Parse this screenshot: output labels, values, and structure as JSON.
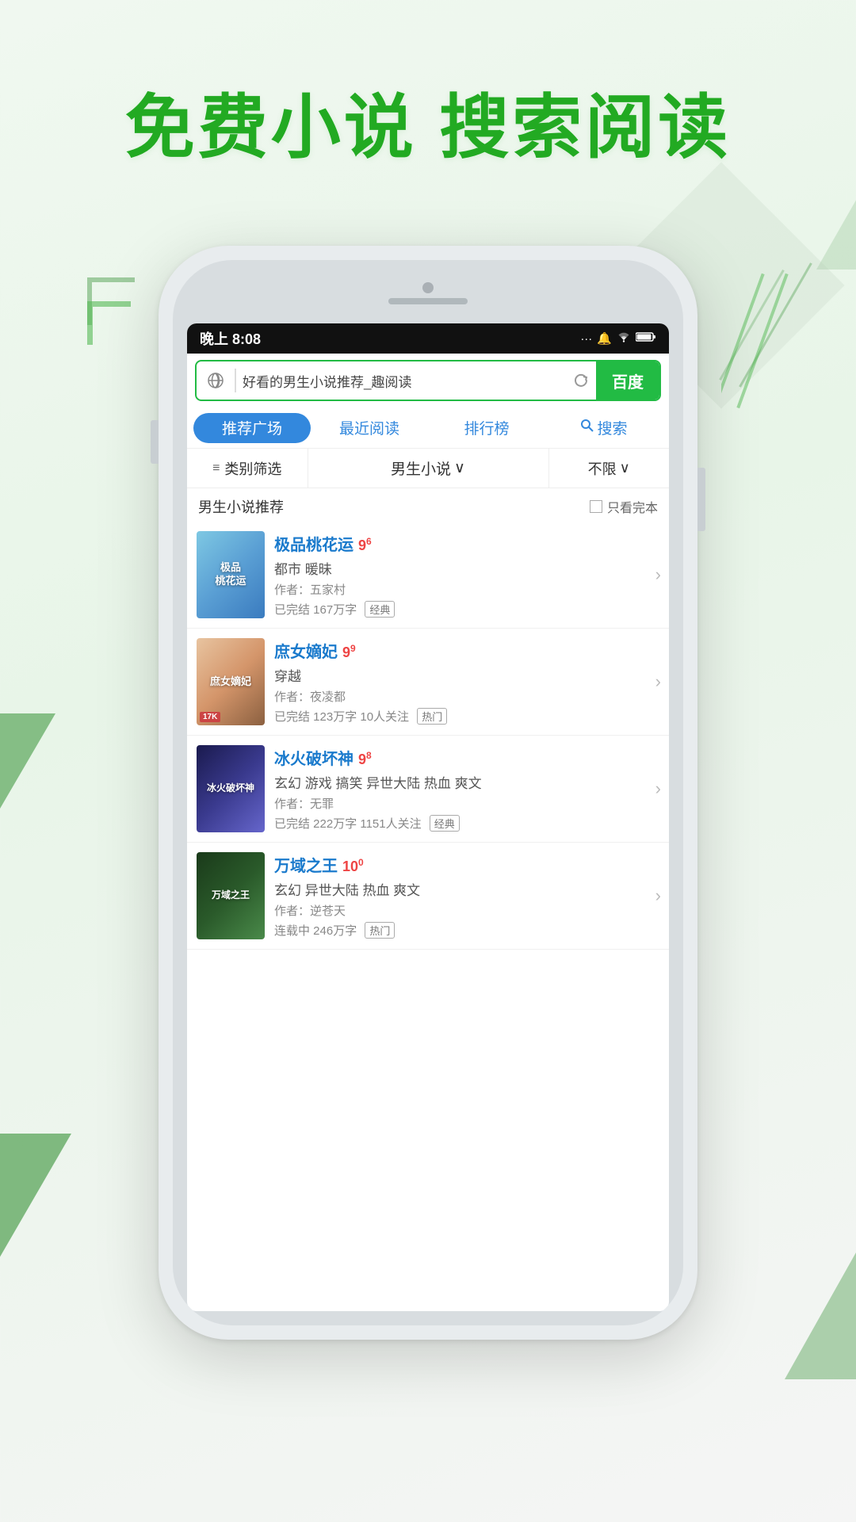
{
  "hero": {
    "text": "免费小说  搜索阅读"
  },
  "status_bar": {
    "time": "晚上 8:08",
    "signal": "...",
    "bell": "🔔",
    "wifi": "WiFi",
    "battery": "⚡"
  },
  "search": {
    "placeholder": "好看的男生小说推荐_趣阅读",
    "baidu_label": "百度"
  },
  "tabs": [
    {
      "label": "推荐广场",
      "active": true
    },
    {
      "label": "最近阅读",
      "active": false
    },
    {
      "label": "排行榜",
      "active": false
    },
    {
      "label": "搜索",
      "active": false,
      "has_icon": true
    }
  ],
  "filters": {
    "category_label": "类别筛选",
    "type_label": "男生小说",
    "type_suffix": "∨",
    "limit_label": "不限",
    "limit_suffix": "∨"
  },
  "section": {
    "title": "男生小说推荐",
    "only_complete": "只看完本"
  },
  "books": [
    {
      "id": 1,
      "title": "极品桃花运",
      "rating": "9",
      "rating_decimal": "6",
      "genre": "都市 暖昧",
      "author": "作者：五家村",
      "meta": "已完结 167万字",
      "tag": "经典",
      "cover_style": "cover1",
      "cover_text": "极品\n桃花运"
    },
    {
      "id": 2,
      "title": "庶女嫡妃",
      "rating": "9",
      "rating_decimal": "9",
      "genre": "穿越",
      "author": "作者：夜凌都",
      "meta": "已完结 123万字 10人关注",
      "tag": "热门",
      "cover_style": "cover2",
      "cover_text": "庶女嫡妃",
      "has_17k": true
    },
    {
      "id": 3,
      "title": "冰火破坏神",
      "rating": "9",
      "rating_decimal": "8",
      "genre": "玄幻 游戏 搞笑 异世大陆 热血 爽文",
      "author": "作者：无罪",
      "meta": "已完结 222万字 1151人关注",
      "tag": "经典",
      "cover_style": "cover3",
      "cover_text": "冰火破坏神"
    },
    {
      "id": 4,
      "title": "万域之王",
      "rating": "10",
      "rating_decimal": "0",
      "genre": "玄幻 异世大陆 热血 爽文",
      "author": "作者：逆苍天",
      "meta": "连载中 246万字",
      "tag": "热门",
      "cover_style": "cover4",
      "cover_text": "万域之王"
    }
  ]
}
